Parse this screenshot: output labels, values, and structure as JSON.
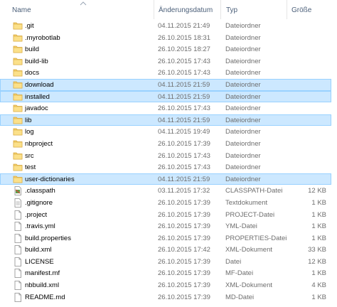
{
  "columns": {
    "name": "Name",
    "date": "Änderungsdatum",
    "type": "Typ",
    "size": "Größe"
  },
  "colors": {
    "selection_bg": "#cce8ff",
    "selection_border": "#99d1ff",
    "folder_yellow": "#f3cf6a"
  },
  "rows": [
    {
      "name": ".git",
      "date": "04.11.2015 21:49",
      "type": "Dateiordner",
      "size": "",
      "icon": "folder-icon",
      "selected": false
    },
    {
      "name": ".myrobotlab",
      "date": "26.10.2015 18:31",
      "type": "Dateiordner",
      "size": "",
      "icon": "folder-icon",
      "selected": false
    },
    {
      "name": "build",
      "date": "26.10.2015 18:27",
      "type": "Dateiordner",
      "size": "",
      "icon": "folder-icon",
      "selected": false
    },
    {
      "name": "build-lib",
      "date": "26.10.2015 17:43",
      "type": "Dateiordner",
      "size": "",
      "icon": "folder-icon",
      "selected": false
    },
    {
      "name": "docs",
      "date": "26.10.2015 17:43",
      "type": "Dateiordner",
      "size": "",
      "icon": "folder-icon",
      "selected": false
    },
    {
      "name": "download",
      "date": "04.11.2015 21:59",
      "type": "Dateiordner",
      "size": "",
      "icon": "folder-icon",
      "selected": true
    },
    {
      "name": "installed",
      "date": "04.11.2015 21:59",
      "type": "Dateiordner",
      "size": "",
      "icon": "folder-icon",
      "selected": true
    },
    {
      "name": "javadoc",
      "date": "26.10.2015 17:43",
      "type": "Dateiordner",
      "size": "",
      "icon": "folder-icon",
      "selected": false
    },
    {
      "name": "lib",
      "date": "04.11.2015 21:59",
      "type": "Dateiordner",
      "size": "",
      "icon": "folder-icon",
      "selected": true
    },
    {
      "name": "log",
      "date": "04.11.2015 19:49",
      "type": "Dateiordner",
      "size": "",
      "icon": "folder-icon",
      "selected": false
    },
    {
      "name": "nbproject",
      "date": "26.10.2015 17:39",
      "type": "Dateiordner",
      "size": "",
      "icon": "folder-icon",
      "selected": false
    },
    {
      "name": "src",
      "date": "26.10.2015 17:43",
      "type": "Dateiordner",
      "size": "",
      "icon": "folder-icon",
      "selected": false
    },
    {
      "name": "test",
      "date": "26.10.2015 17:43",
      "type": "Dateiordner",
      "size": "",
      "icon": "folder-icon",
      "selected": false
    },
    {
      "name": "user-dictionaries",
      "date": "04.11.2015 21:59",
      "type": "Dateiordner",
      "size": "",
      "icon": "folder-icon",
      "selected": true
    },
    {
      "name": ".classpath",
      "date": "03.11.2015 17:32",
      "type": "CLASSPATH-Datei",
      "size": "12 KB",
      "icon": "classpath-file-icon",
      "selected": false
    },
    {
      "name": ".gitignore",
      "date": "26.10.2015 17:39",
      "type": "Textdokument",
      "size": "1 KB",
      "icon": "text-file-icon",
      "selected": false
    },
    {
      "name": ".project",
      "date": "26.10.2015 17:39",
      "type": "PROJECT-Datei",
      "size": "1 KB",
      "icon": "file-icon",
      "selected": false
    },
    {
      "name": ".travis.yml",
      "date": "26.10.2015 17:39",
      "type": "YML-Datei",
      "size": "1 KB",
      "icon": "file-icon",
      "selected": false
    },
    {
      "name": "build.properties",
      "date": "26.10.2015 17:39",
      "type": "PROPERTIES-Datei",
      "size": "1 KB",
      "icon": "file-icon",
      "selected": false
    },
    {
      "name": "build.xml",
      "date": "26.10.2015 17:42",
      "type": "XML-Dokument",
      "size": "33 KB",
      "icon": "file-icon",
      "selected": false
    },
    {
      "name": "LICENSE",
      "date": "26.10.2015 17:39",
      "type": "Datei",
      "size": "12 KB",
      "icon": "file-icon",
      "selected": false
    },
    {
      "name": "manifest.mf",
      "date": "26.10.2015 17:39",
      "type": "MF-Datei",
      "size": "1 KB",
      "icon": "file-icon",
      "selected": false
    },
    {
      "name": "nbbuild.xml",
      "date": "26.10.2015 17:39",
      "type": "XML-Dokument",
      "size": "4 KB",
      "icon": "file-icon",
      "selected": false
    },
    {
      "name": "README.md",
      "date": "26.10.2015 17:39",
      "type": "MD-Datei",
      "size": "1 KB",
      "icon": "file-icon",
      "selected": false
    }
  ]
}
